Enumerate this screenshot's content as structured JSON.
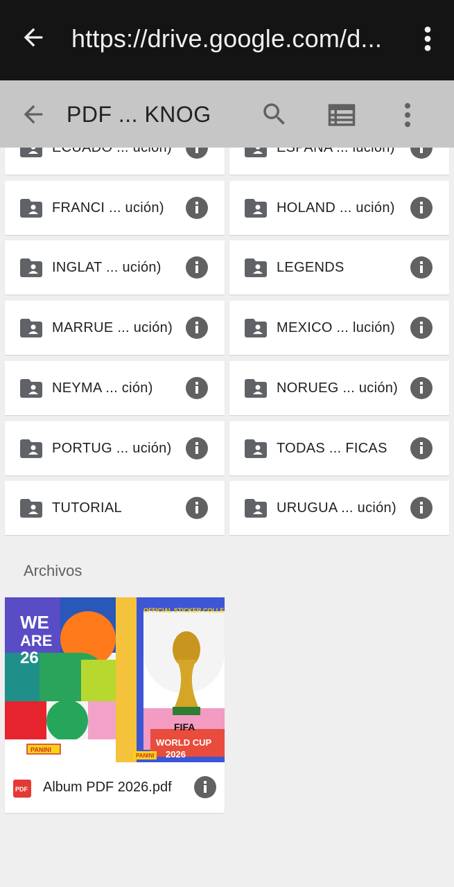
{
  "browser": {
    "url": "https://drive.google.com/d...",
    "back_icon": "arrow-back-icon",
    "menu_icon": "more-vert-icon"
  },
  "toolbar": {
    "title": "PDF ... KNOG",
    "icons": [
      "arrow-back-icon",
      "search-icon",
      "list-view-icon",
      "more-vert-icon"
    ]
  },
  "folders": [
    {
      "name": "ECUADO ... ución)"
    },
    {
      "name": "ESPAÑA ... lución)"
    },
    {
      "name": "FRANCI ... ución)"
    },
    {
      "name": "HOLAND ... ución)"
    },
    {
      "name": "INGLAT ... ución)"
    },
    {
      "name": "LEGENDS"
    },
    {
      "name": "MARRUE ... ución)"
    },
    {
      "name": "MEXICO ... lución)"
    },
    {
      "name": "NEYMA ... ción)"
    },
    {
      "name": "NORUEG ... ución)"
    },
    {
      "name": "PORTUG ... ución)"
    },
    {
      "name": "TODAS ... FICAS"
    },
    {
      "name": "TUTORIAL"
    },
    {
      "name": "URUGUA ... ución)"
    }
  ],
  "files_section": {
    "label": "Archivos",
    "files": [
      {
        "name": "Album PDF 2026.pdf",
        "type_badge": "PDF",
        "thumbnail": {
          "left_text": "WE ARE 26",
          "header": "OFFICIAL STICKER COLLECTION",
          "brand": "PANINI",
          "fifa": "FIFA",
          "event": "WORLD CUP",
          "year": "2026"
        }
      }
    ]
  },
  "colors": {
    "browser_bar": "#141414",
    "toolbar": "#c6c6c6",
    "background": "#efefef",
    "icon_gray": "#5f6368",
    "pdf_red": "#e53935"
  }
}
